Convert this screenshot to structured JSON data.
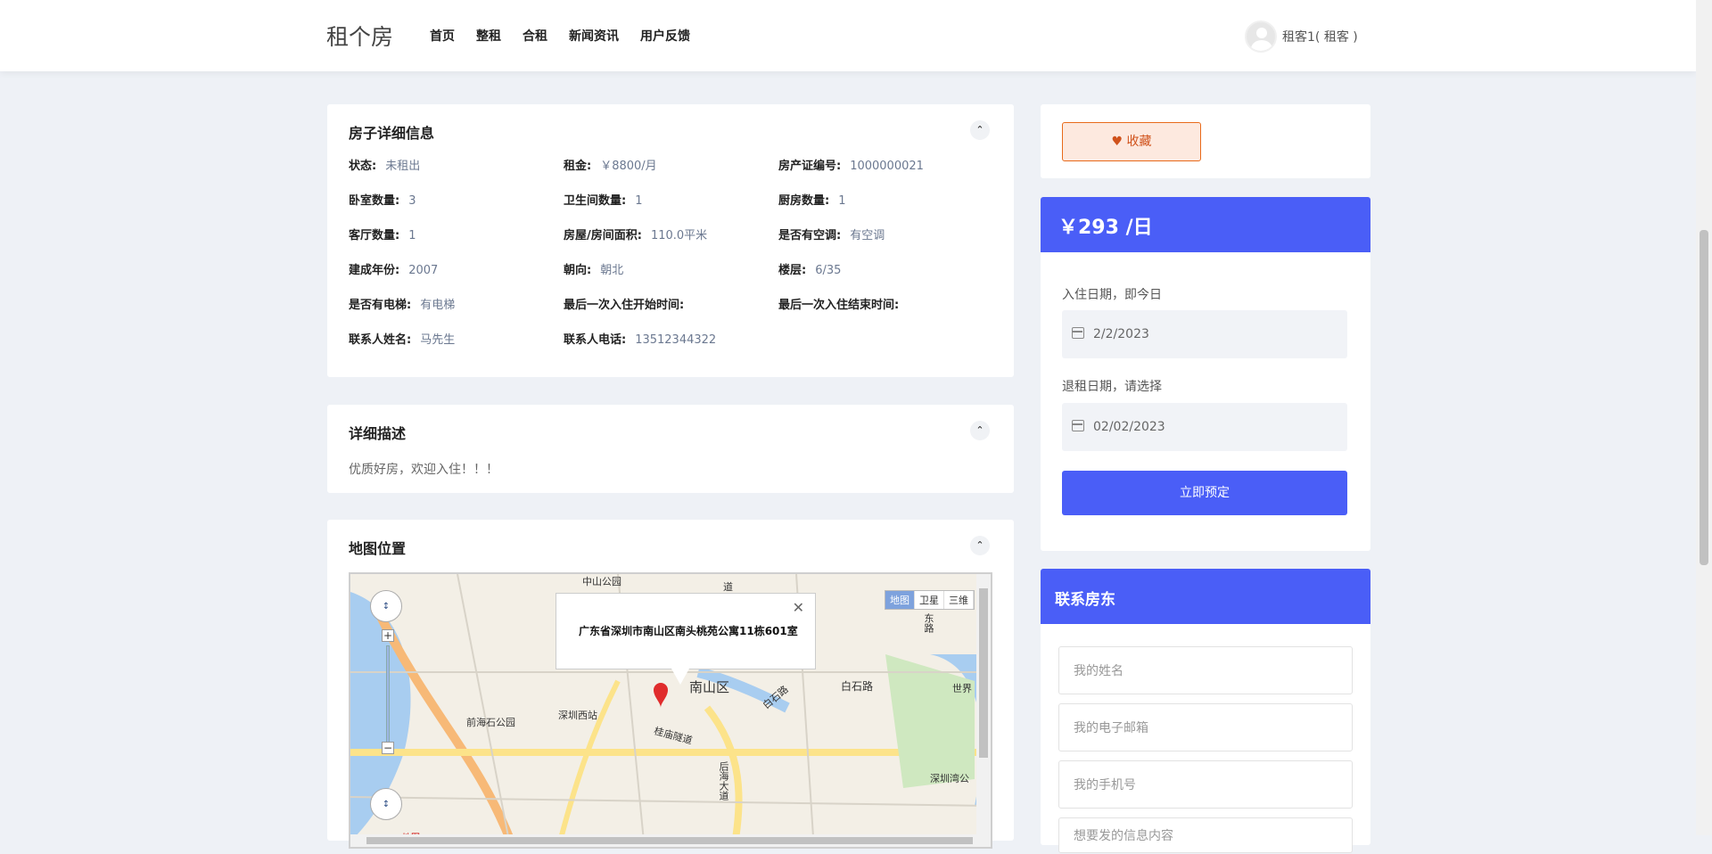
{
  "header": {
    "logo": "租个房",
    "nav": [
      "首页",
      "整租",
      "合租",
      "新闻资讯",
      "用户反馈"
    ],
    "user": "租客1( 租客 )"
  },
  "detail": {
    "title": "房子详细信息",
    "rows": [
      [
        {
          "k": "状态:",
          "v": "未租出"
        },
        {
          "k": "租金:",
          "v": "￥8800/月"
        },
        {
          "k": "房产证编号:",
          "v": "1000000021"
        }
      ],
      [
        {
          "k": "卧室数量:",
          "v": "3"
        },
        {
          "k": "卫生间数量:",
          "v": "1"
        },
        {
          "k": "厨房数量:",
          "v": "1"
        }
      ],
      [
        {
          "k": "客厅数量:",
          "v": "1"
        },
        {
          "k": "房屋/房间面积:",
          "v": "110.0平米"
        },
        {
          "k": "是否有空调:",
          "v": "有空调"
        }
      ],
      [
        {
          "k": "建成年份:",
          "v": "2007"
        },
        {
          "k": "朝向:",
          "v": "朝北"
        },
        {
          "k": "楼层:",
          "v": "6/35"
        }
      ],
      [
        {
          "k": "是否有电梯:",
          "v": "有电梯"
        },
        {
          "k": "最后一次入住开始时间:",
          "v": ""
        },
        {
          "k": "最后一次入住结束时间:",
          "v": ""
        }
      ],
      [
        {
          "k": "联系人姓名:",
          "v": "马先生"
        },
        {
          "k": "联系人电话:",
          "v": "13512344322"
        },
        {
          "k": "",
          "v": ""
        }
      ]
    ]
  },
  "description": {
    "title": "详细描述",
    "text": "优质好房，欢迎入住！！！"
  },
  "map": {
    "title": "地图位置",
    "popup": "广东省深圳市南山区南头桃苑公寓11栋601室",
    "types": [
      "地图",
      "卫星",
      "三维"
    ],
    "labels": [
      "南山区",
      "白石路",
      "深圳西站",
      "前海石公园",
      "桂庙隧道",
      "后海大道",
      "深圳湾公",
      "世界",
      "道",
      "中山公园",
      "东路",
      "白石路",
      "地图"
    ]
  },
  "sidebar": {
    "favorite": "收藏",
    "price": "￥293 /日",
    "checkin_label": "入住日期，即今日",
    "checkin_value": "2/2/2023",
    "checkout_label": "退租日期，请选择",
    "checkout_value": "02/02/2023",
    "book_button": "立即预定"
  },
  "contact": {
    "title": "联系房东",
    "name_placeholder": "我的姓名",
    "email_placeholder": "我的电子邮箱",
    "phone_placeholder": "我的手机号",
    "message_placeholder": "想要发的信息内容"
  },
  "colors": {
    "primary": "#4a5ef7",
    "favorite_border": "#e86a1a",
    "favorite_bg": "#fde9df",
    "page_bg": "#eef1f6"
  }
}
